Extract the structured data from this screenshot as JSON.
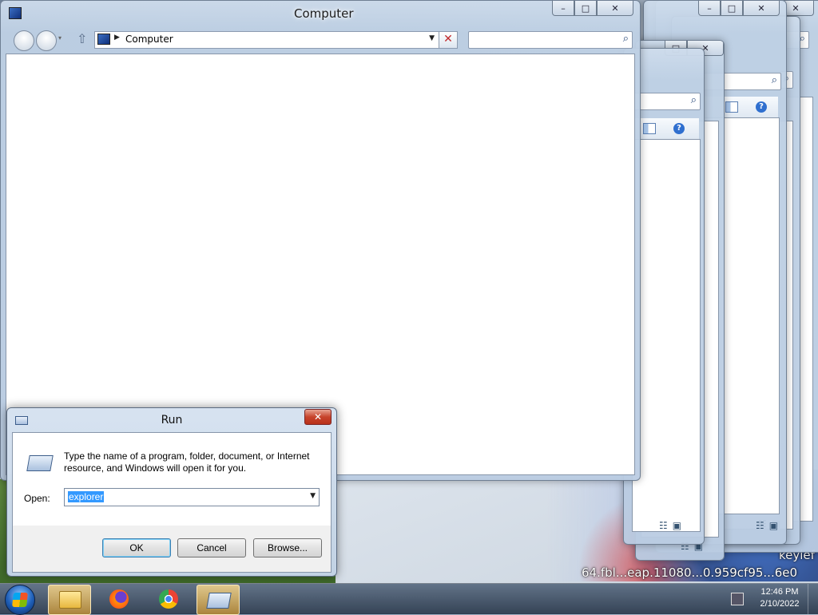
{
  "main_window": {
    "title": "Computer",
    "address": "Computer",
    "search_placeholder": ""
  },
  "caption_buttons": {
    "minimize": "–",
    "maximize": "□",
    "close": "✕"
  },
  "run_dialog": {
    "title": "Run",
    "close": "✕",
    "message": "Type the name of a program, folder, document, or Internet resource, and Windows will open it for you.",
    "open_label": "Open:",
    "open_value": "explorer",
    "ok_label": "OK",
    "cancel_label": "Cancel",
    "browse_label": "Browse..."
  },
  "taskbar": {
    "items": [
      {
        "name": "Windows Explorer",
        "icon": "folder-icon",
        "active": true
      },
      {
        "name": "Firefox",
        "icon": "firefox-icon",
        "active": false
      },
      {
        "name": "Chrome",
        "icon": "chrome-icon",
        "active": false
      },
      {
        "name": "Run",
        "icon": "run-icon",
        "active": true
      }
    ],
    "time": "12:46 PM",
    "date": "2/10/2022"
  },
  "desktop": {
    "wallpaper_text_1": "keylef",
    "wallpaper_text_2": "64.fbl...eap.11080...0.959cf95...6e0"
  },
  "colors": {
    "accent": "#3399ff",
    "close_red": "#c7442c"
  }
}
